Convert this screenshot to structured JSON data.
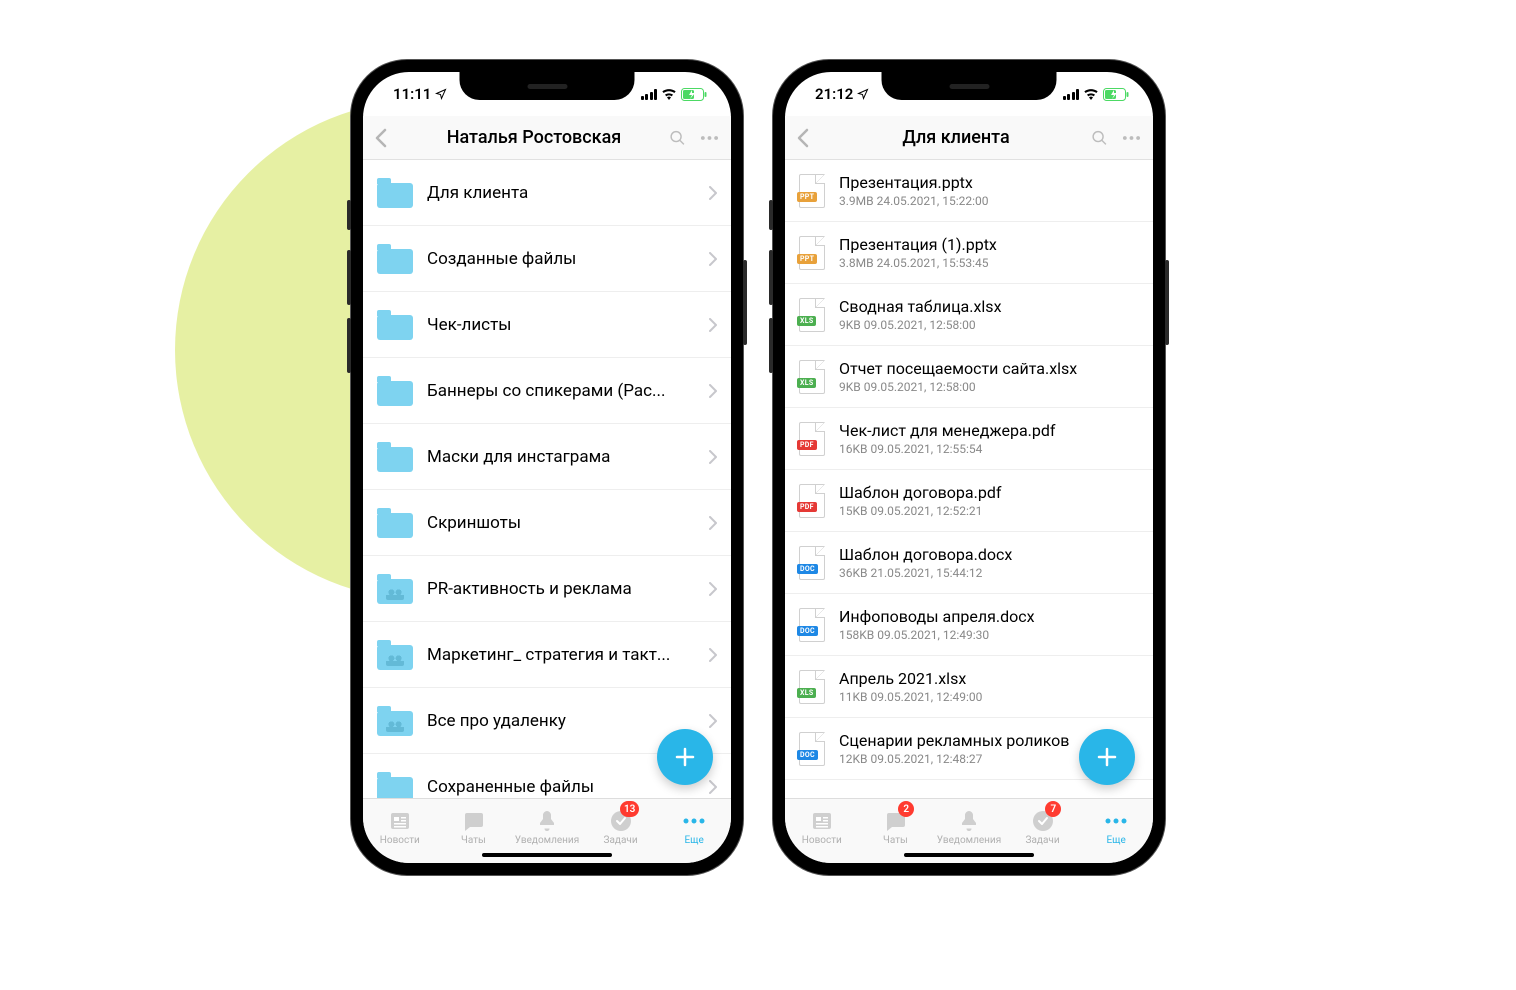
{
  "phone1": {
    "status_time": "11:11",
    "nav_title": "Наталья Ростовская",
    "folders": [
      {
        "name": "Для клиента",
        "shared": false
      },
      {
        "name": "Созданные файлы",
        "shared": false
      },
      {
        "name": "Чек-листы",
        "shared": false
      },
      {
        "name": "Баннеры со спикерами (Рас...",
        "shared": false
      },
      {
        "name": "Маски для инстаграма",
        "shared": false
      },
      {
        "name": "Скриншоты",
        "shared": false
      },
      {
        "name": "PR-активность и реклама",
        "shared": true
      },
      {
        "name": "Маркетинг_ стратегия и такт...",
        "shared": true
      },
      {
        "name": "Все про удаленку",
        "shared": true
      },
      {
        "name": "Сохраненные файлы",
        "shared": false
      }
    ],
    "tabs_badges": {
      "chats": null,
      "tasks": "13"
    }
  },
  "phone2": {
    "status_time": "21:12",
    "nav_title": "Для клиента",
    "files": [
      {
        "name": "Презентация.pptx",
        "meta": "3.9MB 24.05.2021, 15:22:00",
        "type": "ppt"
      },
      {
        "name": "Презентация (1).pptx",
        "meta": "3.8MB 24.05.2021, 15:53:45",
        "type": "ppt"
      },
      {
        "name": "Сводная таблица.xlsx",
        "meta": "9KB 09.05.2021, 12:58:00",
        "type": "xls"
      },
      {
        "name": "Отчет посещаемости сайта.xlsx",
        "meta": "9KB 09.05.2021, 12:58:00",
        "type": "xls"
      },
      {
        "name": "Чек-лист для менеджера.pdf",
        "meta": "16KB 09.05.2021, 12:55:54",
        "type": "pdf"
      },
      {
        "name": "Шаблон договора.pdf",
        "meta": "15KB 09.05.2021, 12:52:21",
        "type": "pdf"
      },
      {
        "name": "Шаблон договора.docx",
        "meta": "36KB 21.05.2021, 15:44:12",
        "type": "doc"
      },
      {
        "name": "Инфоповоды апреля.docx",
        "meta": "158KB 09.05.2021, 12:49:30",
        "type": "doc"
      },
      {
        "name": "Апрель 2021.xlsx",
        "meta": "11KB 09.05.2021, 12:49:00",
        "type": "xls"
      },
      {
        "name": "Сценарии рекламных роликов",
        "meta": "12KB 09.05.2021, 12:48:27",
        "type": "doc"
      }
    ],
    "tabs_badges": {
      "chats": "2",
      "tasks": "7"
    }
  },
  "tabbar": {
    "news": "Новости",
    "chats": "Чаты",
    "notifications": "Уведомления",
    "tasks": "Задачи",
    "more": "Еще"
  },
  "file_badges": {
    "ppt": "PPT",
    "xls": "XLS",
    "pdf": "PDF",
    "doc": "DOC"
  },
  "colors": {
    "accent": "#29b6e8"
  }
}
